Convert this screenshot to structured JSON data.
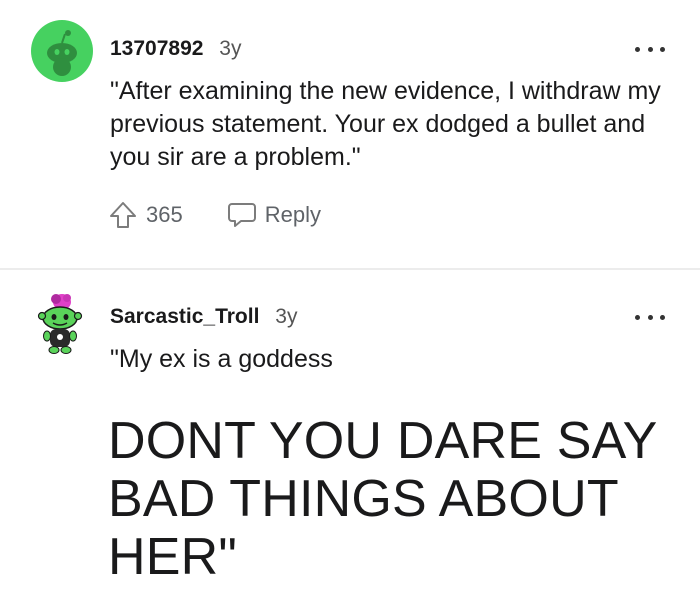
{
  "comments": [
    {
      "username": "13707892",
      "age": "3y",
      "text": "\"After examining the new evidence, I withdraw my previous statement. Your ex dodged a bullet and you sir are a problem.\"",
      "votes": "365",
      "reply_label": "Reply",
      "avatar_icon": "reddit-snoo-avatar",
      "more_icon": "more-options-icon"
    },
    {
      "username": "Sarcastic_Troll",
      "age": "3y",
      "text_line1": "\"My ex is a goddess",
      "text_big": "DONT YOU DARE SAY BAD THINGS ABOUT HER\"",
      "avatar_icon": "custom-snoo-avatar",
      "more_icon": "more-options-icon"
    }
  ],
  "colors": {
    "avatar_green": "#46d160",
    "text": "#1a1a1b",
    "muted": "#5f6368",
    "divider": "#ececec"
  }
}
